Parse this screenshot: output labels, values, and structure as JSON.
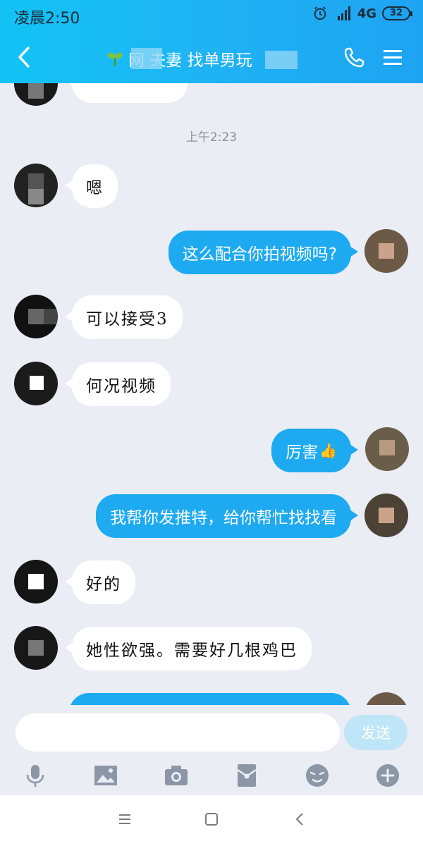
{
  "status_bar": {
    "time": "凌晨2:50",
    "network": "4G",
    "battery": "32"
  },
  "header": {
    "title": "网 夫妻 找单男玩",
    "icons": {
      "back": "back-arrow-icon",
      "phone": "phone-icon",
      "menu": "menu-icon",
      "group": "sprout-icon"
    }
  },
  "chat": {
    "timestamp": "上午2:23",
    "messages": [
      {
        "side": "in",
        "text": "嗯"
      },
      {
        "side": "out",
        "text": "这么配合你拍视频吗?"
      },
      {
        "side": "in",
        "text": "可以接受3"
      },
      {
        "side": "in",
        "text": "何况视频"
      },
      {
        "side": "out",
        "text": "厉害"
      },
      {
        "side": "out",
        "text": "我帮你发推特，给你帮忙找找看"
      },
      {
        "side": "in",
        "text": "好的"
      },
      {
        "side": "in",
        "text": "她性欲强。需要好几根鸡巴"
      }
    ],
    "emoji": "👍"
  },
  "input": {
    "placeholder": "",
    "send_label": "发送"
  },
  "toolbar": [
    "mic-icon",
    "image-icon",
    "camera-icon",
    "red-packet-icon",
    "emoji-icon",
    "plus-icon"
  ],
  "colors": {
    "header_start": "#12c3f5",
    "header_end": "#1ea3f2",
    "bubble_out": "#1eaaf1",
    "bubble_in": "#ffffff",
    "background": "#eaedf4"
  }
}
